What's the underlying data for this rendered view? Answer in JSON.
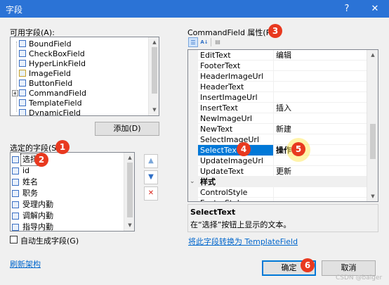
{
  "window": {
    "title": "字段",
    "help": "?",
    "close": "✕"
  },
  "available": {
    "label": "可用字段(A):",
    "items": [
      {
        "label": "BoundField",
        "icon": "field-icon",
        "expand": ""
      },
      {
        "label": "CheckBoxField",
        "icon": "checkbox-icon",
        "expand": ""
      },
      {
        "label": "HyperLinkField",
        "icon": "hyperlink-icon",
        "expand": ""
      },
      {
        "label": "ImageField",
        "icon": "image-icon",
        "expand": ""
      },
      {
        "label": "ButtonField",
        "icon": "button-icon",
        "expand": ""
      },
      {
        "label": "CommandField",
        "icon": "command-icon",
        "expand": "+"
      },
      {
        "label": "TemplateField",
        "icon": "template-icon",
        "expand": ""
      },
      {
        "label": "DynamicField",
        "icon": "dynamic-icon",
        "expand": ""
      }
    ],
    "add_button": "添加(D)"
  },
  "selected": {
    "label": "选定的字段(S):",
    "items": [
      "选择",
      "id",
      "姓名",
      "职务",
      "受理内勤",
      "调解内勤",
      "指导内勤"
    ],
    "selected_index": 0
  },
  "side_buttons": {
    "up": "▲",
    "down": "▼",
    "delete": "✕"
  },
  "auto_generate": {
    "label": "自动生成字段(G)",
    "checked": false
  },
  "refresh_link": "刷新架构",
  "properties": {
    "label": "CommandField 属性(P):",
    "rows": [
      {
        "name": "EditText",
        "value": "编辑"
      },
      {
        "name": "FooterText",
        "value": ""
      },
      {
        "name": "HeaderImageUrl",
        "value": ""
      },
      {
        "name": "HeaderText",
        "value": ""
      },
      {
        "name": "InsertImageUrl",
        "value": ""
      },
      {
        "name": "InsertText",
        "value": "插入"
      },
      {
        "name": "NewImageUrl",
        "value": ""
      },
      {
        "name": "NewText",
        "value": "新建"
      },
      {
        "name": "SelectImageUrl",
        "value": ""
      },
      {
        "name": "SelectText",
        "value": "操作"
      },
      {
        "name": "UpdateImageUrl",
        "value": ""
      },
      {
        "name": "UpdateText",
        "value": "更新"
      }
    ],
    "category": "样式",
    "category_rows": [
      {
        "name": "ControlStyle",
        "value": ""
      },
      {
        "name": "FooterStyle",
        "value": ""
      }
    ],
    "selected_row": 9,
    "desc_title": "SelectText",
    "desc_text": "在“选择”按钮上显示的文本。"
  },
  "convert_link": "将此字段转换为 TemplateField",
  "ok_button": "确定",
  "cancel_button": "取消",
  "badges": [
    "1",
    "2",
    "3",
    "4",
    "5",
    "6"
  ],
  "watermark": "CSDN @baiger",
  "colors": {
    "titlebar": "#2b73d6",
    "selection": "#0078d7",
    "badge": "#e8391f",
    "link": "#0066cc"
  }
}
